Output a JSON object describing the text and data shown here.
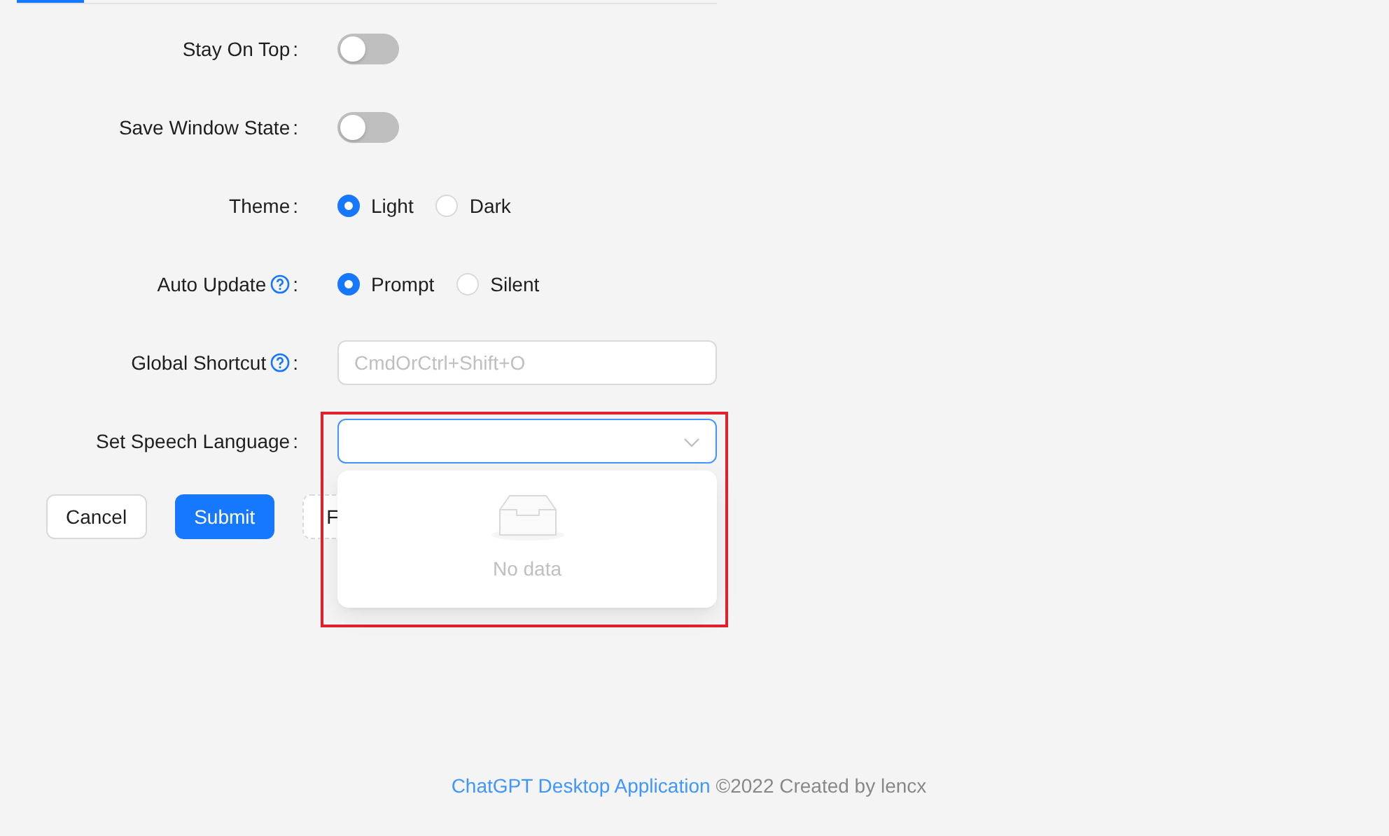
{
  "tabs": [
    {
      "selected": true
    }
  ],
  "form": [
    {
      "kind": "switch",
      "label": "Stay On Top",
      "colon": ":",
      "on": false
    },
    {
      "kind": "switch",
      "label": "Save Window State",
      "colon": ":",
      "on": false
    },
    {
      "kind": "radio",
      "label": "Theme",
      "colon": ":",
      "options": [
        {
          "label": "Light",
          "selected": true
        },
        {
          "label": "Dark",
          "selected": false
        }
      ]
    },
    {
      "kind": "radio",
      "label": "Auto Update",
      "help": true,
      "colon": ":",
      "options": [
        {
          "label": "Prompt",
          "selected": true
        },
        {
          "label": "Silent",
          "selected": false
        }
      ]
    },
    {
      "kind": "input",
      "label": "Global Shortcut",
      "help": true,
      "colon": ":",
      "placeholder": "CmdOrCtrl+Shift+O"
    },
    {
      "kind": "select",
      "label": "Set Speech Language",
      "colon": ":",
      "expanded": true,
      "empty_text": "No data",
      "highlighted": true
    }
  ],
  "buttons": [
    {
      "label": "Cancel",
      "kind": "default"
    },
    {
      "label": "Submit",
      "kind": "primary"
    },
    {
      "label": "F",
      "kind": "dashed"
    }
  ],
  "footer": {
    "link": "ChatGPT Desktop Application",
    "text": "©2022 Created by lencx"
  }
}
